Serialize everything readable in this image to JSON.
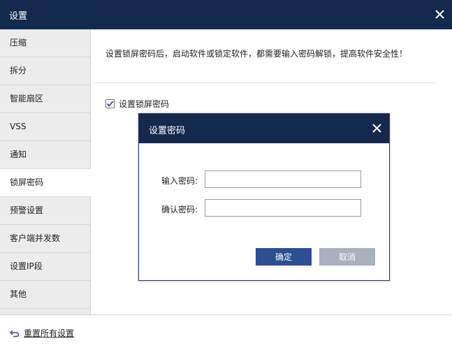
{
  "window": {
    "title": "设置"
  },
  "sidebar": {
    "items": [
      {
        "label": "压缩"
      },
      {
        "label": "拆分"
      },
      {
        "label": "智能扇区"
      },
      {
        "label": "VSS"
      },
      {
        "label": "通知"
      },
      {
        "label": "锁屏密码",
        "active": true
      },
      {
        "label": "预警设置"
      },
      {
        "label": "客户端并发数"
      },
      {
        "label": "设置IP段"
      },
      {
        "label": "其他"
      }
    ]
  },
  "main": {
    "description": "设置锁屏密码后，启动软件或锁定软件，都需要输入密码解锁，提高软件安全性！",
    "lock_checkbox": {
      "label": "设置锁屏密码",
      "checked": true
    }
  },
  "footer": {
    "reset_label": "重置所有设置"
  },
  "dialog": {
    "title": "设置密码",
    "password_label": "输入密码:",
    "password_value": "",
    "confirm_label": "确认密码:",
    "confirm_value": "",
    "ok_label": "确定",
    "cancel_label": "取消"
  },
  "colors": {
    "titlebar": "#13294e",
    "primary_button": "#2b4f92",
    "disabled_button": "#a7b1c0",
    "sidebar_bg": "#ececec"
  },
  "icons": {
    "window_close": "close-icon",
    "dialog_close": "close-icon",
    "checkbox": "checkmark-icon",
    "reset": "undo-arrow-icon"
  }
}
